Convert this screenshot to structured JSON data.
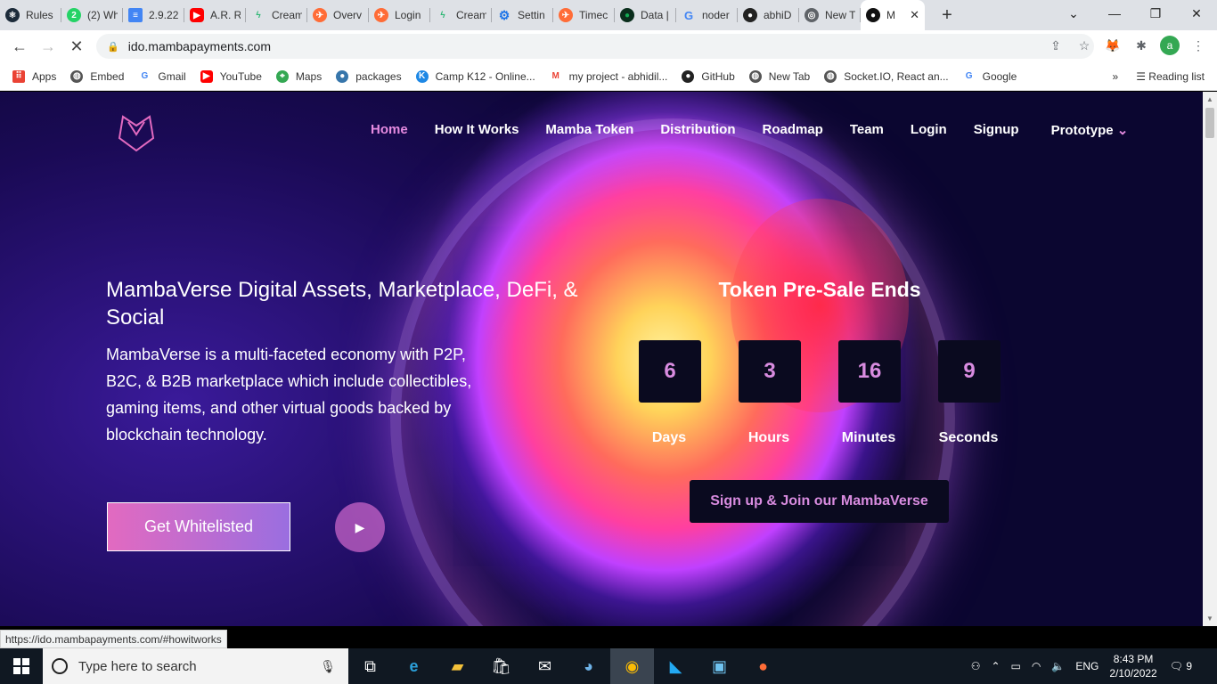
{
  "browser": {
    "tabs": [
      {
        "title": "Rules",
        "icon": "react-icon",
        "color": "#1c2b3a"
      },
      {
        "title": "(2) Wh",
        "icon": "whatsapp-icon",
        "color": "#25d366"
      },
      {
        "title": "2.9.22",
        "icon": "docs-icon",
        "color": "#4285f4"
      },
      {
        "title": "A.R. R",
        "icon": "youtube-icon",
        "color": "#ff0000"
      },
      {
        "title": "Cream",
        "icon": "bolt-icon",
        "color": "#2bb673"
      },
      {
        "title": "Overv",
        "icon": "postman-icon",
        "color": "#ff6c37"
      },
      {
        "title": "Login",
        "icon": "postman-icon",
        "color": "#ff6c37"
      },
      {
        "title": "Cream",
        "icon": "bolt-icon",
        "color": "#2bb673"
      },
      {
        "title": "Settin",
        "icon": "gear-icon",
        "color": "#1a73e8"
      },
      {
        "title": "Timec",
        "icon": "postman-icon",
        "color": "#ff6c37"
      },
      {
        "title": "Data |",
        "icon": "mongodb-icon",
        "color": "#13aa52"
      },
      {
        "title": "noder",
        "icon": "google-icon",
        "color": "#4285f4"
      },
      {
        "title": "abhiD",
        "icon": "github-icon",
        "color": "#222222"
      },
      {
        "title": "New T",
        "icon": "chrome-icon",
        "color": "#5f6368"
      },
      {
        "title": "M",
        "icon": "mamba-icon",
        "color": "#111111"
      }
    ],
    "new_tab": "+",
    "url": "ido.mambapayments.com",
    "bookmarks": [
      {
        "label": "Apps",
        "icon": "apps-icon"
      },
      {
        "label": "Embed",
        "icon": "globe-icon"
      },
      {
        "label": "Gmail",
        "icon": "google-icon"
      },
      {
        "label": "YouTube",
        "icon": "youtube-icon"
      },
      {
        "label": "Maps",
        "icon": "maps-icon"
      },
      {
        "label": "packages",
        "icon": "python-icon"
      },
      {
        "label": "Camp K12 - Online...",
        "icon": "campk12-icon"
      },
      {
        "label": "my project - abhidil...",
        "icon": "gmail-icon"
      },
      {
        "label": "GitHub",
        "icon": "github-icon"
      },
      {
        "label": "New Tab",
        "icon": "globe-icon"
      },
      {
        "label": "Socket.IO, React an...",
        "icon": "globe-icon"
      },
      {
        "label": "Google",
        "icon": "google-icon"
      }
    ],
    "bookmarks_more": "»",
    "reading_list": "Reading list",
    "avatar_letter": "a",
    "status_url": "https://ido.mambapayments.com/#howitworks"
  },
  "site": {
    "nav": [
      "Home",
      "How It Works",
      "Mamba Token",
      "Distribution",
      "Roadmap",
      "Team",
      "Login",
      "Signup"
    ],
    "nav_prototype": "Prototype",
    "hero_title": "MambaVerse Digital Assets, Marketplace, DeFi, & Social",
    "hero_description": "MambaVerse is a multi-faceted economy with P2P, B2C, & B2B marketplace which include collectibles, gaming items, and other virtual goods backed by blockchain technology.",
    "cta_label": "Get Whitelisted",
    "countdown_title": "Token Pre-Sale Ends",
    "countdown": [
      {
        "value": "6",
        "label": "Days"
      },
      {
        "value": "3",
        "label": "Hours"
      },
      {
        "value": "16",
        "label": "Minutes"
      },
      {
        "value": "9",
        "label": "Seconds"
      }
    ],
    "signup_label": "Sign up & Join our MambaVerse",
    "accent": "#e58be0"
  },
  "taskbar": {
    "search_placeholder": "Type here to search",
    "language": "ENG",
    "time": "8:43 PM",
    "date": "2/10/2022",
    "notifications": "9"
  }
}
